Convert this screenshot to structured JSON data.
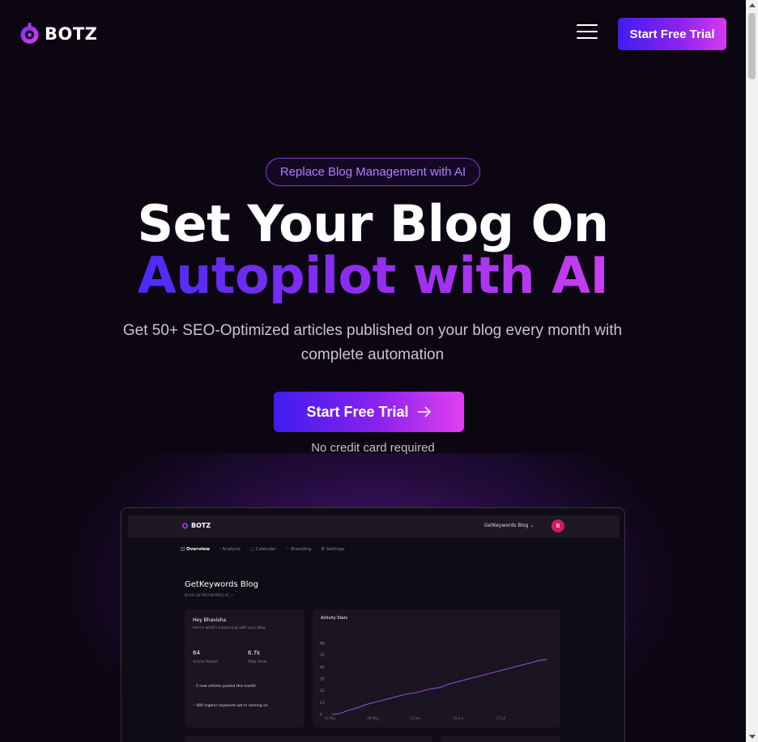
{
  "brand": {
    "name": "BOTZ"
  },
  "header": {
    "menu_icon": "hamburger-icon",
    "cta_label": "Start Free Trial"
  },
  "hero": {
    "badge": "Replace Blog Management with AI",
    "title_line1": "Set Your Blog On",
    "title_line2": "Autopilot with AI",
    "subtitle": "Get 50+ SEO-Optimized articles published on your blog every month with complete automation",
    "cta_label": "Start Free Trial",
    "cta_icon": "arrow-right-icon",
    "note": "No credit card required"
  },
  "colors": {
    "accent_start": "#3e1ef0",
    "accent_mid": "#8a22ee",
    "accent_end": "#d43bf0",
    "background": "#0b0612"
  },
  "dashboard": {
    "brand": "BOTZ",
    "blog_selector": "GetKeywords Blog",
    "avatar_initial": "B",
    "tabs": [
      "Overview",
      "Analysis",
      "Calendar",
      "Branding",
      "Settings"
    ],
    "title": "GetKeywords Blog",
    "url": "BLOG.GETKEYWORDS.IO",
    "greeting": "Hey Bhavisha",
    "greeting_sub": "Here's what's happening with your Blog.",
    "stats": [
      {
        "value": "64",
        "label": "Article Posted"
      },
      {
        "value": "6.7k",
        "label": "Total Visits"
      }
    ],
    "highlights": [
      "5 new articles posted this month",
      "480 organic keywords we're ranking on"
    ],
    "activity": {
      "title": "Activity Stats",
      "y_ticks": [
        "0",
        "11",
        "22",
        "33",
        "44",
        "55",
        "66"
      ],
      "x_ticks": [
        "13 May",
        "26 May",
        "11 Jun",
        "23 Jun",
        "17 Jul"
      ]
    }
  },
  "chart_data": {
    "type": "line",
    "title": "Activity Stats",
    "ylim": [
      0,
      66
    ],
    "series": [
      {
        "values": [
          0,
          1,
          4,
          6,
          9,
          11,
          13,
          15,
          17,
          19,
          20,
          22,
          24,
          25,
          28,
          30,
          32,
          34,
          36,
          38,
          40,
          42,
          44,
          46,
          48,
          50,
          51
        ]
      }
    ]
  }
}
